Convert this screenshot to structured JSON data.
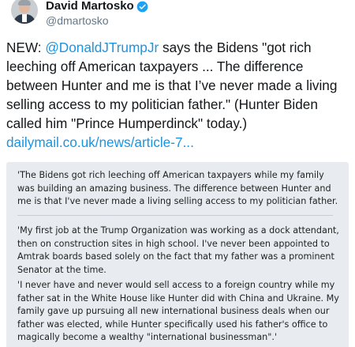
{
  "author": {
    "display_name": "David Martosko",
    "handle": "@dmartosko",
    "verified": true
  },
  "tweet": {
    "prefix": "NEW: ",
    "mention": "@DonaldJTrumpJr",
    "body": " says the Bidens \"got rich leeching off American taxpayers ... The difference between Hunter and me is that I’ve never made a living selling access to my politician father.\" (Hunter Biden called him \"Prince Humperdinck\" today.)",
    "link": "dailymail.co.uk/news/article-7..."
  },
  "quote_image": {
    "paragraphs": [
      "'The Bidens got rich leeching off American taxpayers while my family was building an amazing business. The difference between Hunter and me is that I've never made a living selling access to my politician father.",
      "'My first job at the Trump Organization was working as a dock attendant, then on construction sites in high school. I've never been appointed to Amtrak boards based solely on the fact that my father was a prominent Senator at the time.",
      "'I never have and never would sell access to a foreign country while my father sat in the White House like Hunter did with China and Ukraine. My family gave up pursuing all new international business deals when our father was elected, while Hunter specifically used his father's office to magically become a wealthy \"international businessman\".'"
    ]
  },
  "colors": {
    "link": "#1b95e0",
    "verified_badge": "#1da1f2",
    "quote_bg": "#e8ecf0"
  }
}
